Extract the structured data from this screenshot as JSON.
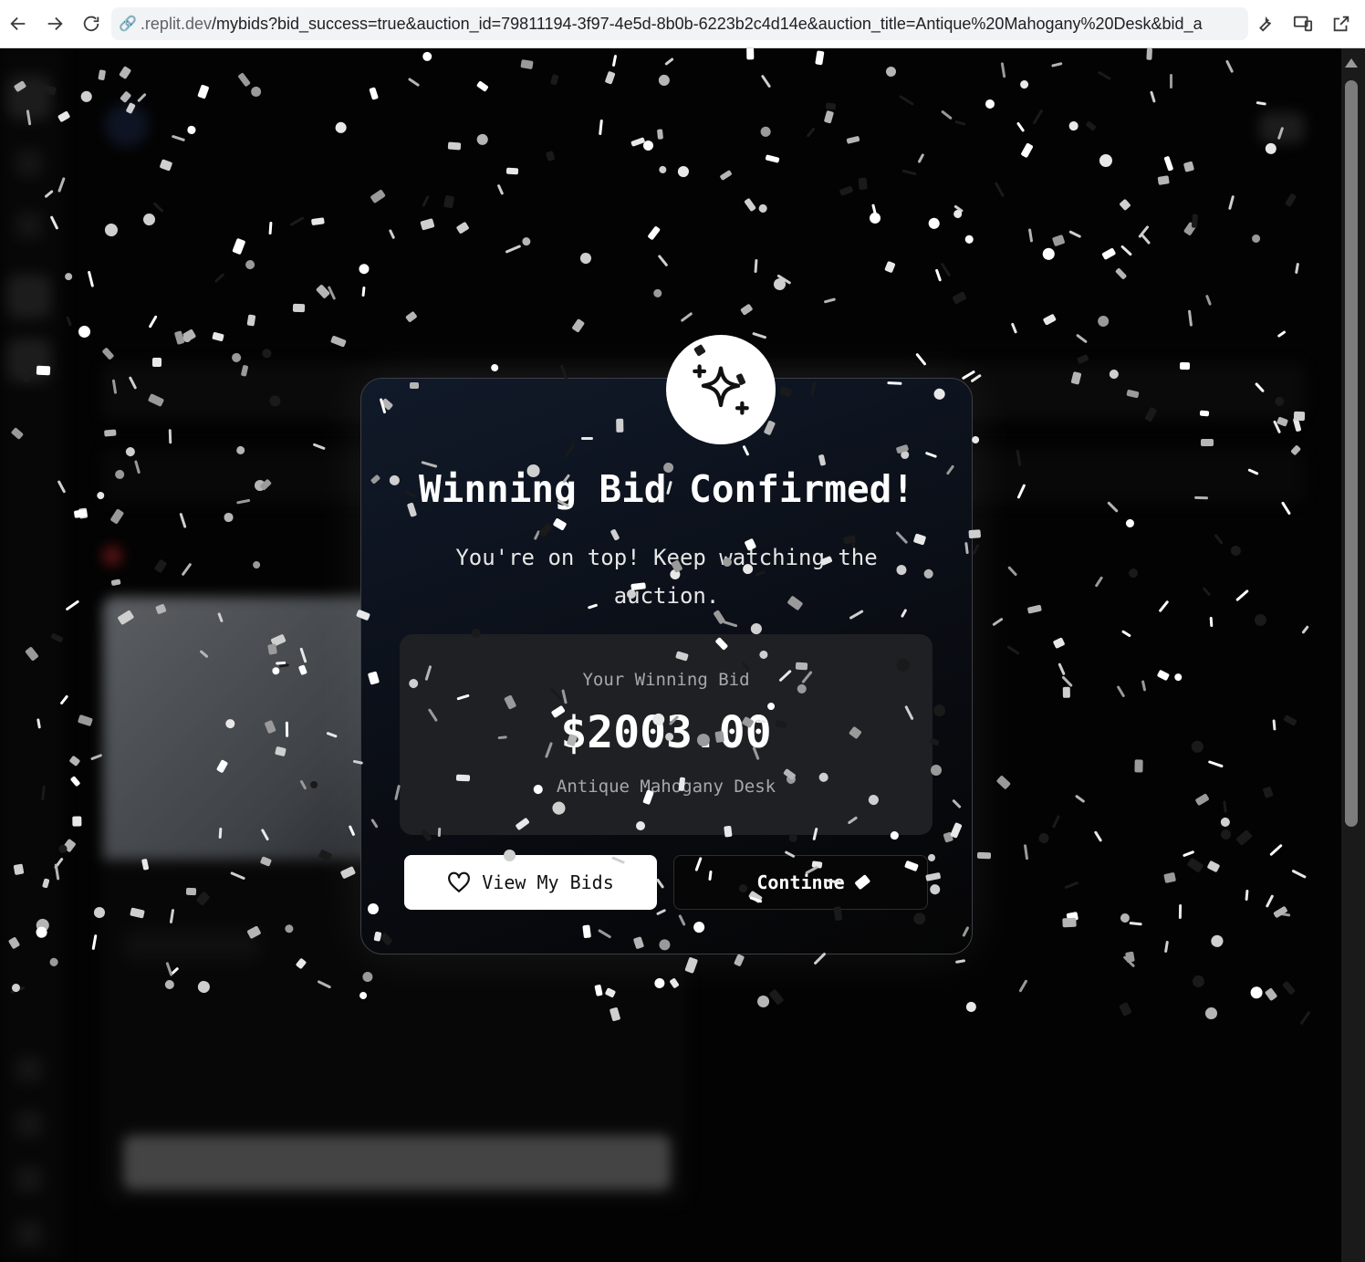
{
  "browser": {
    "url_host": ".replit.dev",
    "url_path": "/mybids?bid_success=true&auction_id=79811194-3f97-4e5d-8b0b-6223b2c4d14e&auction_title=Antique%20Mahogany%20Desk&bid_a",
    "icons": [
      "back-arrow-icon",
      "forward-arrow-icon",
      "reload-icon",
      "link-icon",
      "wrench-icon",
      "devices-icon",
      "open-external-icon"
    ]
  },
  "modal": {
    "title": "Winning Bid Confirmed!",
    "subtitle": "You're on top! Keep watching the auction.",
    "bid_label": "Your Winning Bid",
    "bid_amount": "$2003.00",
    "auction_title": "Antique Mahogany Desk",
    "view_bids_label": "View My Bids",
    "continue_label": "Continue",
    "badge_icon": "sparkles-icon",
    "view_bids_icon": "heart-icon"
  },
  "colors": {
    "modal_bg": "#0a0d14",
    "primary_button": "#ffffff",
    "secondary_button": "#060606",
    "confetti": "#ffffff"
  }
}
